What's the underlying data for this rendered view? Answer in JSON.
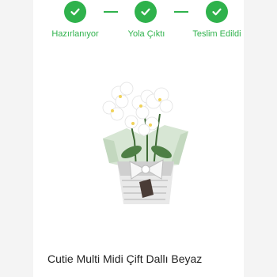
{
  "tracker": {
    "steps": [
      {
        "label": "Hazırlanıyor",
        "status": "done",
        "icon": "check-icon"
      },
      {
        "label": "Yola Çıktı",
        "status": "done",
        "icon": "check-icon"
      },
      {
        "label": "Teslim Edildi",
        "status": "done",
        "icon": "check-icon"
      }
    ],
    "accent_color": "#2fb24c"
  },
  "product": {
    "title": "Cutie Multi Midi Çift Dallı Beyaz",
    "image_icon": "orchid-plant-image"
  }
}
